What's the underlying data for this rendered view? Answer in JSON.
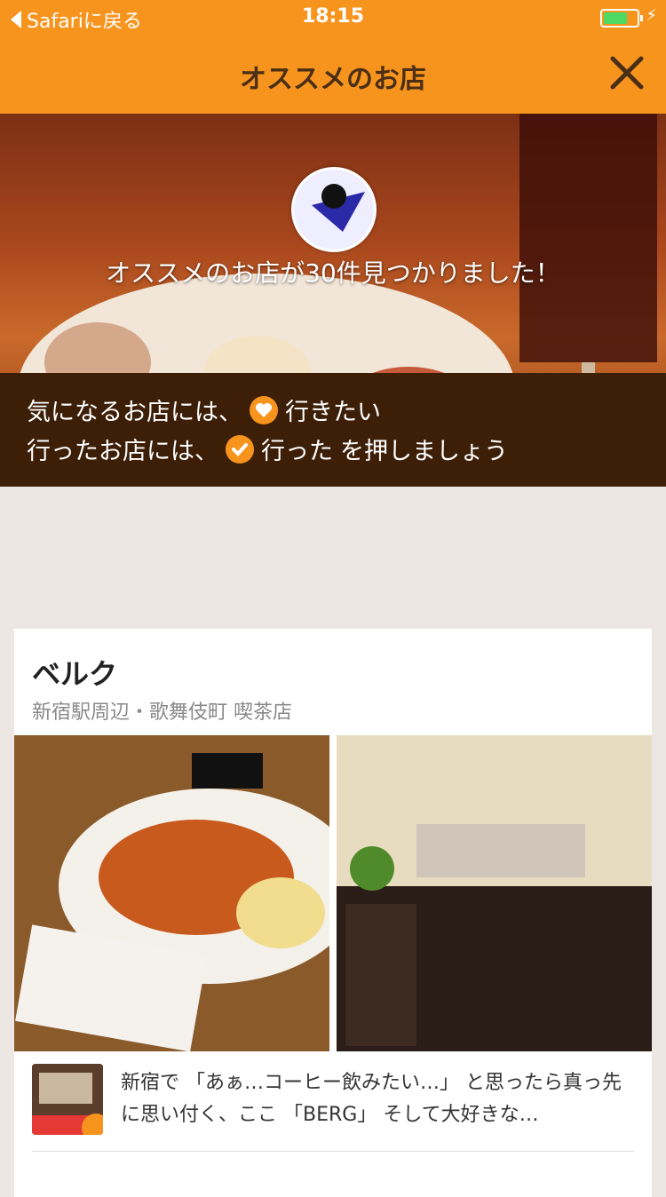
{
  "status": {
    "back_label": "Safariに戻る",
    "time": "18:15"
  },
  "nav": {
    "title": "オススメのお店",
    "close_icon": "close-icon"
  },
  "hero": {
    "headline": "オススメのお店が30件見つかりました！",
    "line1_prefix": "気になるお店には、",
    "line1_action": "行きたい",
    "line2_prefix": "行ったお店には、",
    "line2_action": "行った",
    "line2_suffix": "を押しましょう"
  },
  "card": {
    "name": "ベルク",
    "area": "新宿駅周辺・歌舞伎町 喫茶店",
    "post": "新宿で 「あぁ…コーヒー飲みたい…」 と思ったら真っ先に思い付く、ここ 「BERG」 そして大好きな…"
  },
  "colors": {
    "accent": "#f7941e",
    "dark": "#3d1f08"
  }
}
